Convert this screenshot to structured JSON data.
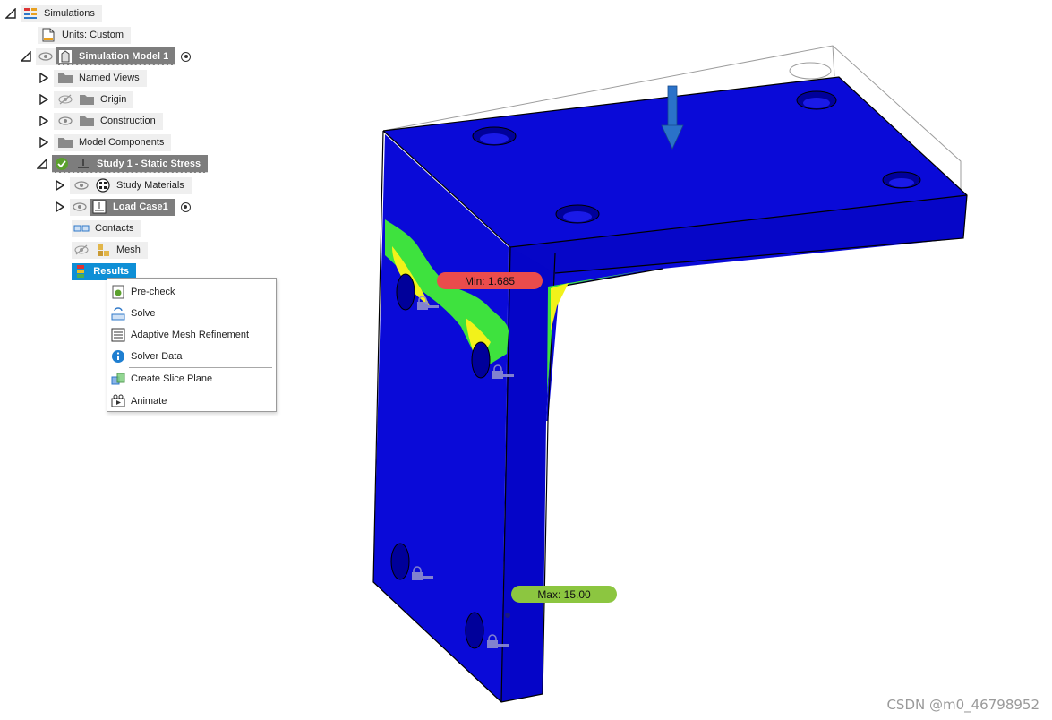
{
  "browser": {
    "root": {
      "label": "Simulations",
      "icon": "simulations-icon"
    },
    "units": {
      "label": "Units: Custom",
      "icon": "document-icon"
    },
    "model": {
      "label": "Simulation Model 1",
      "icon": "model-icon"
    },
    "items": [
      {
        "label": "Named Views",
        "icon": "folder-icon",
        "visibility": "none"
      },
      {
        "label": "Origin",
        "icon": "folder-icon",
        "visibility": "hidden"
      },
      {
        "label": "Construction",
        "icon": "folder-icon",
        "visibility": "visible"
      },
      {
        "label": "Model Components",
        "icon": "folder-icon",
        "visibility": "none"
      }
    ],
    "study": {
      "label": "Study 1 - Static Stress",
      "status_icon": "check-circle-icon",
      "type_icon": "static-stress-icon"
    },
    "study_items": {
      "materials": {
        "label": "Study Materials",
        "icon": "materials-icon"
      },
      "load_case": {
        "label": "Load Case1",
        "icon": "load-case-icon"
      },
      "contacts": {
        "label": "Contacts",
        "icon": "contacts-icon"
      },
      "mesh": {
        "label": "Mesh",
        "icon": "mesh-icon"
      },
      "results": {
        "label": "Results",
        "icon": "results-icon"
      }
    }
  },
  "context_menu": {
    "items": [
      {
        "label": "Pre-check",
        "icon": "precheck-icon"
      },
      {
        "label": "Solve",
        "icon": "solve-icon"
      },
      {
        "label": "Adaptive Mesh Refinement",
        "icon": "mesh-refinement-icon"
      },
      {
        "label": "Solver Data",
        "icon": "info-icon"
      },
      {
        "label": "Create Slice Plane",
        "icon": "slice-plane-icon"
      },
      {
        "label": "Animate",
        "icon": "animate-icon"
      }
    ]
  },
  "viewport": {
    "min_probe": "Min: 1.685",
    "max_probe": "Max: 15.00",
    "colors": {
      "part_blue": "#0a0ad8",
      "stress_green": "#3ee23e",
      "stress_yellow": "#f2f21a",
      "min_label": "#ea4c4c",
      "max_label": "#8cc640",
      "selection": "#0e8fd6"
    }
  },
  "watermark": "CSDN @m0_46798952"
}
